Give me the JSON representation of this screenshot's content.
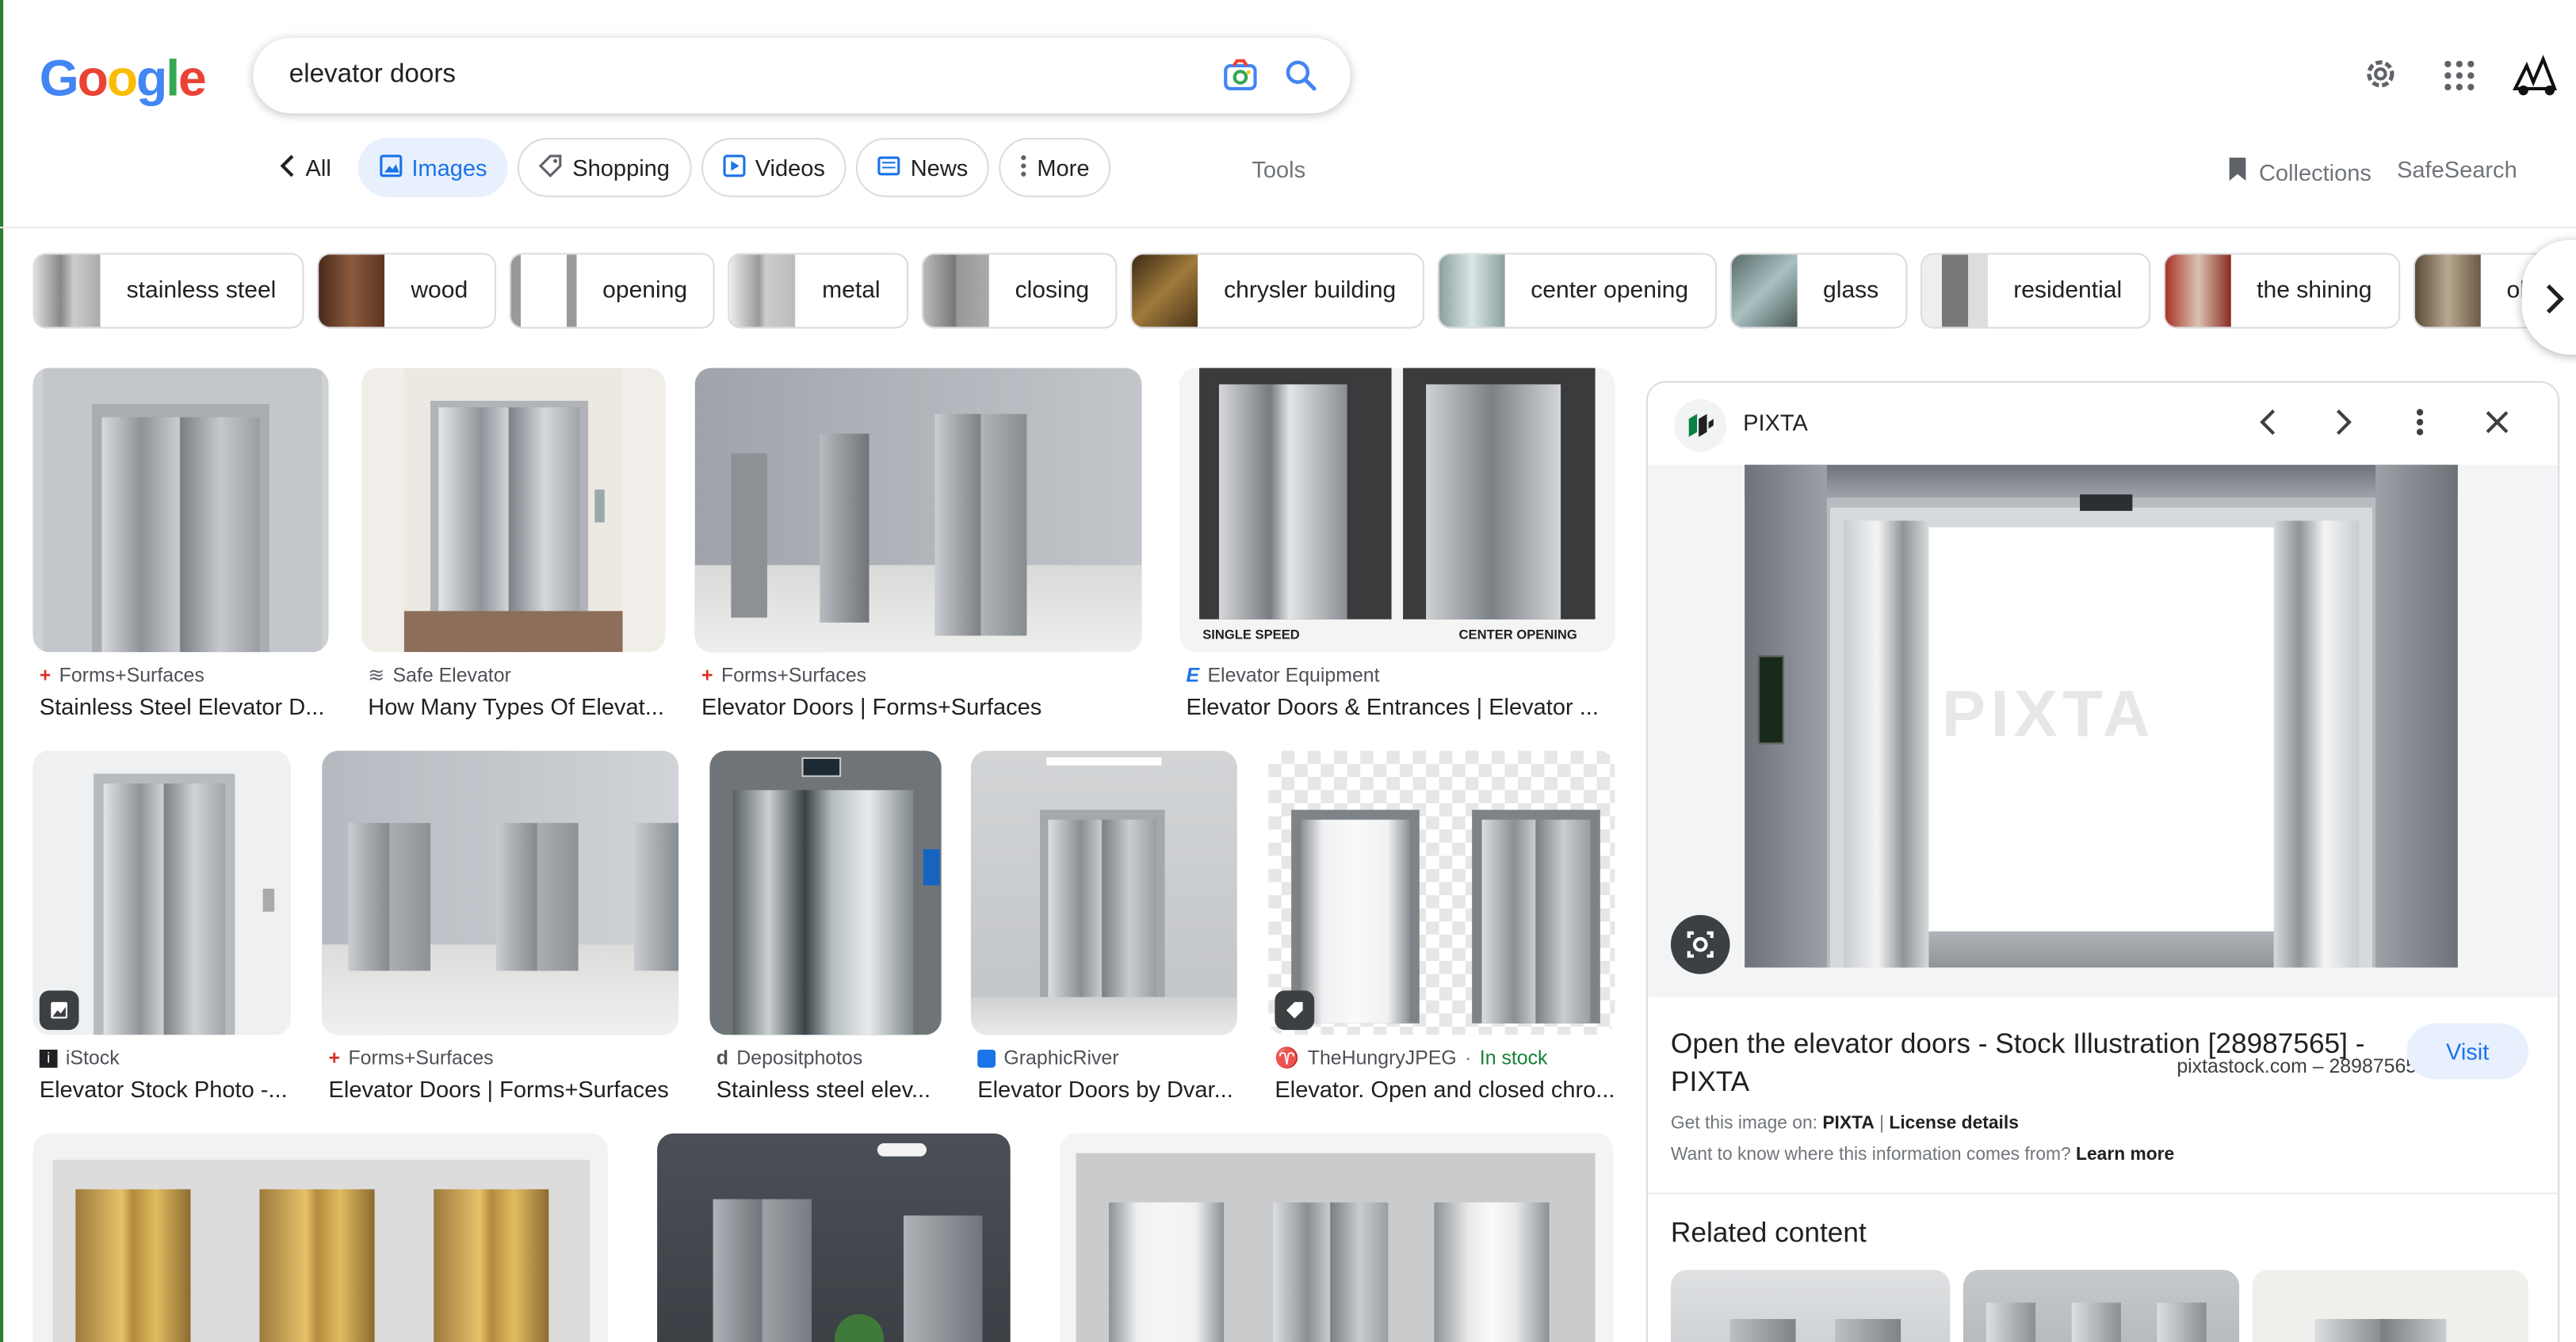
{
  "google_logo": {
    "letters": [
      "G",
      "o",
      "o",
      "g",
      "l",
      "e"
    ],
    "colors": [
      "#4285F4",
      "#EA4335",
      "#FBBC05",
      "#4285F4",
      "#34A853",
      "#EA4335"
    ]
  },
  "search": {
    "query": "elevator doors",
    "camera_icon": "camera-icon",
    "search_icon": "search-icon"
  },
  "header_icons": [
    "gear-icon",
    "apps-grid-icon",
    "account-avatar-icon"
  ],
  "tabs": {
    "back": "All",
    "items": [
      {
        "label": "Images",
        "icon": "image-icon",
        "selected": true
      },
      {
        "label": "Shopping",
        "icon": "tag-icon"
      },
      {
        "label": "Videos",
        "icon": "video-icon"
      },
      {
        "label": "News",
        "icon": "news-icon"
      },
      {
        "label": "More",
        "icon": "more-vert-icon"
      }
    ],
    "tools": "Tools",
    "collections": "Collections",
    "safesearch": "SafeSearch"
  },
  "chips": [
    "stainless steel",
    "wood",
    "opening",
    "metal",
    "closing",
    "chrysler building",
    "center opening",
    "glass",
    "residential",
    "the shining",
    "old f"
  ],
  "results": [
    {
      "source": "Forms+Surfaces",
      "title": "Stainless Steel Elevator D..."
    },
    {
      "source": "Safe Elevator",
      "title": "How Many Types Of Elevat..."
    },
    {
      "source": "Forms+Surfaces",
      "title": "Elevator Doors | Forms+Surfaces"
    },
    {
      "source": "Elevator Equipment",
      "title": "Elevator Doors & Entrances | Elevator ...",
      "labels": [
        "SINGLE SPEED",
        "CENTER OPENING"
      ]
    },
    {
      "source": "iStock",
      "title": "Elevator Stock Photo -..."
    },
    {
      "source": "Forms+Surfaces",
      "title": "Elevator Doors | Forms+Surfaces"
    },
    {
      "source": "Depositphotos",
      "title": "Stainless steel elev..."
    },
    {
      "source": "GraphicRiver",
      "title": "Elevator Doors by Dvar..."
    },
    {
      "source": "TheHungryJPEG",
      "stock": "In stock",
      "title": "Elevator. Open and closed chro..."
    }
  ],
  "panel": {
    "site": "PIXTA",
    "image_credit": "pixtastock.com – 28987565",
    "watermark": "PIXTA",
    "title": "Open the elevator doors - Stock Illustration [28987565] - PIXTA",
    "visit": "Visit",
    "get_prefix": "Get this image on:",
    "get_site": "PIXTA",
    "license": "License details",
    "want": "Want to know where this information comes from?",
    "learn_more": "Learn more",
    "related": "Related content"
  }
}
